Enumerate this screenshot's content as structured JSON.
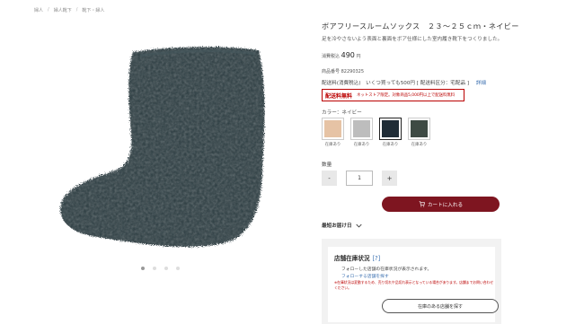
{
  "breadcrumb": [
    "婦人",
    "婦人靴下",
    "靴下・婦人"
  ],
  "product": {
    "title": "ボアフリースルームソックス　２３～２５ｃｍ・ネイビー",
    "description": "足を冷やさないよう表面と裏面をボア仕様にした室内履き靴下をつくりました。",
    "price_label": "消費税込",
    "price": "490",
    "price_unit": "円",
    "sku": "商品番号 82290325",
    "shipping": "配送料(消費税込)　いくつ買っても500円 [ 配送料区分：宅配品 ]",
    "shipping_link": "詳細",
    "free_tag": "配送料無料",
    "free_note": "ネットストア限定。対象商品5,000円以上で配送料無料"
  },
  "color": {
    "label": "カラー：ネイビー",
    "options": [
      {
        "name": "beige",
        "hex": "#e6c3a5",
        "stock": "在庫あり"
      },
      {
        "name": "gray",
        "hex": "#bdbdbd",
        "stock": "在庫あり"
      },
      {
        "name": "navy",
        "hex": "#1f2c36",
        "stock": "在庫あり"
      },
      {
        "name": "dark-green",
        "hex": "#3e4a44",
        "stock": "在庫あり"
      }
    ]
  },
  "quantity": {
    "label": "数量",
    "minus": "-",
    "value": "1",
    "plus": "+"
  },
  "cart_button": "カートに入れる",
  "delivery_label": "最短お届け日",
  "store": {
    "title": "店舗在庫状況",
    "help": "[?]",
    "line1": "フォローした店舗の在庫状況が表示されます。",
    "line2": "フォローする店舗を探す",
    "warning": "※在庫状況は変動するため、売り切れや品切れ表示となっている場合があります。店舗までお問い合わせください。",
    "button": "在庫のある店舗を探す"
  },
  "gallery": {
    "dots": 4,
    "active": 0
  },
  "colors": {
    "accent": "#7e1520",
    "sock": "#2c3a40",
    "link": "#3a6fb0"
  }
}
